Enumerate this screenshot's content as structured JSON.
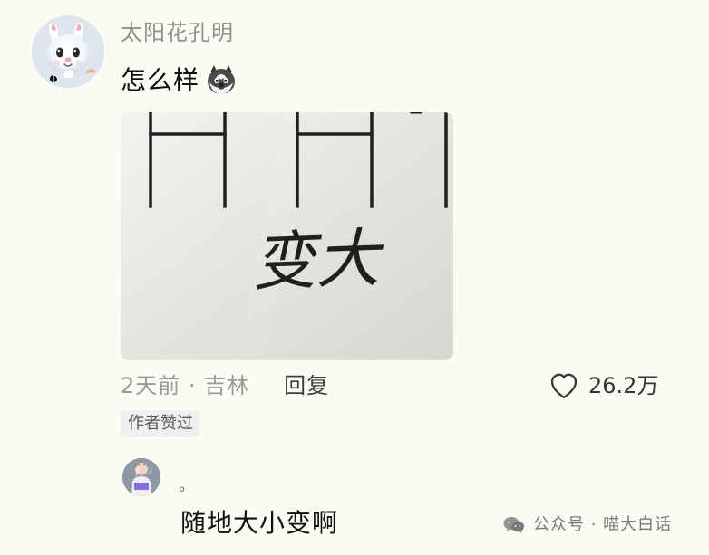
{
  "comment": {
    "username": "太阳花孔明",
    "text": "怎么样",
    "emoji_icon": "husky-face-icon",
    "image": {
      "icon": "photo-icon",
      "handwritten_text": "变大"
    },
    "time_location": "2天前 · 吉林",
    "reply_label": "回复",
    "like_icon": "heart-icon",
    "like_count": "26.2万",
    "author_badge": "作者赞过"
  },
  "reply": {
    "avatar_icon": "avatar-icon",
    "dot": "。",
    "text": "随地大小变啊"
  },
  "watermark": {
    "icon": "wechat-icon",
    "text": "公众号 · 喵大白话"
  },
  "colors": {
    "background": "#fbfbf4",
    "username": "#8f8f8f",
    "meta": "#999999",
    "text": "#111111",
    "badge_bg": "#efefef"
  }
}
